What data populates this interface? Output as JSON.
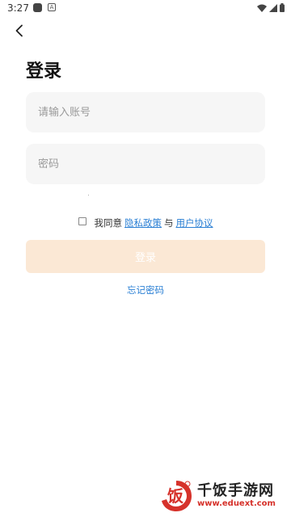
{
  "status_bar": {
    "time": "3:27",
    "a_icon_text": "A"
  },
  "header": {
    "back_icon": "chevron-left-icon"
  },
  "title": "登录",
  "account_field": {
    "placeholder": "请输入账号",
    "value": ""
  },
  "password_field": {
    "placeholder": "密码",
    "value": ""
  },
  "agreement": {
    "prefix": "我同意",
    "privacy_link": "隐私政策",
    "separator": "与",
    "terms_link": "用户协议",
    "checked": false
  },
  "login_button": {
    "label": "登录"
  },
  "forgot_password": {
    "label": "忘记密码"
  },
  "watermark": {
    "logo_char": "饭",
    "name": "千饭手游网",
    "url": "www.eduext.com"
  },
  "colors": {
    "link": "#2a7fd4",
    "button_disabled": "#fbe8d5",
    "field_bg": "#f6f6f6",
    "watermark_red": "#d6322b"
  }
}
